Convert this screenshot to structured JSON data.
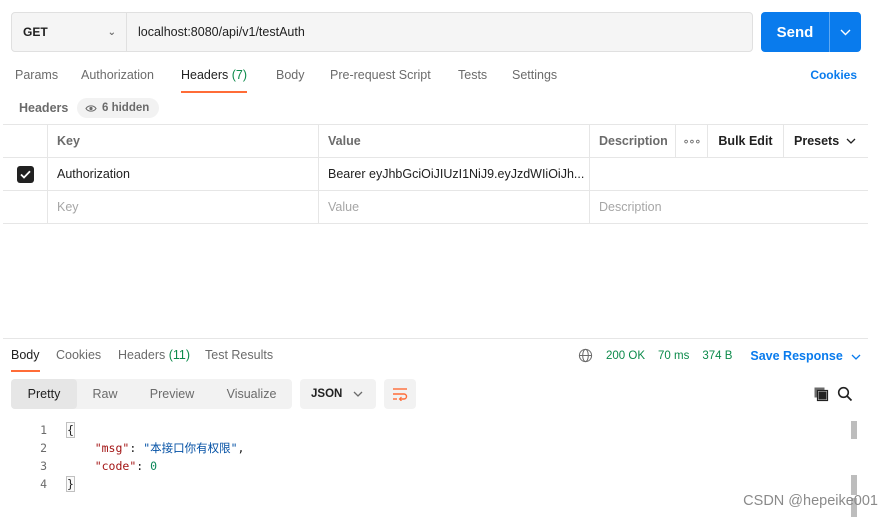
{
  "request": {
    "method": "GET",
    "url": "localhost:8080/api/v1/testAuth",
    "send_label": "Send"
  },
  "request_tabs": [
    {
      "label": "Params"
    },
    {
      "label": "Authorization"
    },
    {
      "label": "Headers",
      "count": "(7)"
    },
    {
      "label": "Body"
    },
    {
      "label": "Pre-request Script"
    },
    {
      "label": "Tests"
    },
    {
      "label": "Settings"
    }
  ],
  "cookies_link": "Cookies",
  "headers_section": {
    "title": "Headers",
    "hidden_badge": "6 hidden"
  },
  "table": {
    "columns": [
      "Key",
      "Value",
      "Description"
    ],
    "dots": "∘∘∘",
    "bulk_edit": "Bulk Edit",
    "presets": "Presets",
    "rows": [
      {
        "checked": true,
        "key": "Authorization",
        "value": "Bearer eyJhbGciOiJIUzI1NiJ9.eyJzdWIiOiJh...",
        "description": ""
      }
    ],
    "placeholder": {
      "key": "Key",
      "value": "Value",
      "description": "Description"
    }
  },
  "response_tabs": [
    {
      "label": "Body"
    },
    {
      "label": "Cookies"
    },
    {
      "label": "Headers",
      "count": "(11)"
    },
    {
      "label": "Test Results"
    }
  ],
  "status": {
    "code": "200 OK",
    "time": "70 ms",
    "size": "374 B",
    "save_label": "Save Response"
  },
  "view_modes": [
    "Pretty",
    "Raw",
    "Preview",
    "Visualize"
  ],
  "format": "JSON",
  "code_lines": [
    {
      "n": "1",
      "text": "{"
    },
    {
      "n": "2",
      "key": "\"msg\"",
      "sep": ": ",
      "val": "\"本接口你有权限\"",
      "tail": ","
    },
    {
      "n": "3",
      "key": "\"code\"",
      "sep": ": ",
      "num": "0"
    },
    {
      "n": "4",
      "text": "}"
    }
  ],
  "watermark": "CSDN @hepeike001",
  "colors": {
    "accent": "#097bed",
    "tab_active": "#ff6c37",
    "status_green": "#0b8a4a"
  }
}
